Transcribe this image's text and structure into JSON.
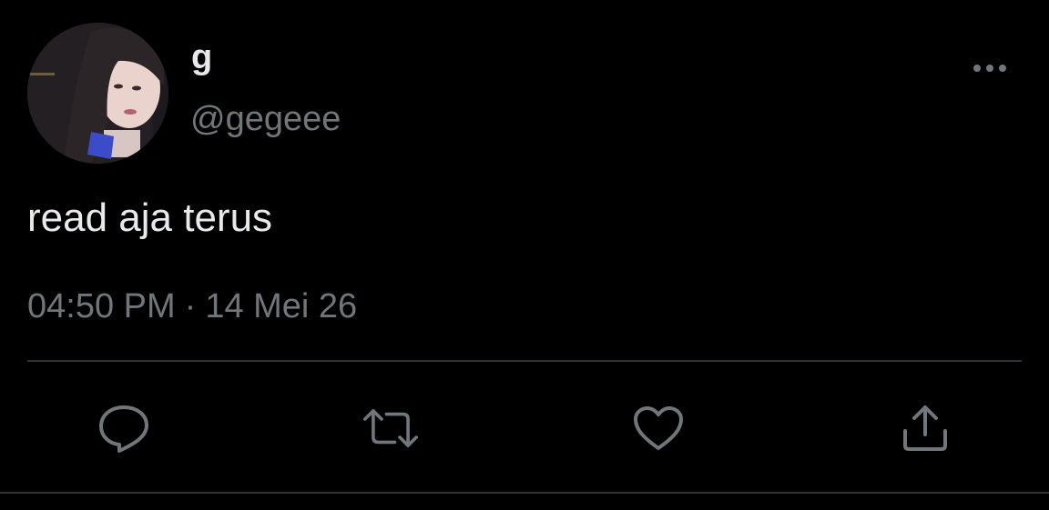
{
  "tweet": {
    "display_name": "g",
    "handle": "@gegeee",
    "text": "read aja terus",
    "time": "04:50 PM",
    "separator": "·",
    "date": "14 Mei 26"
  },
  "icons": {
    "more": "more-horizontal-icon",
    "reply": "reply-icon",
    "retweet": "retweet-icon",
    "like": "heart-icon",
    "share": "share-icon"
  },
  "colors": {
    "background": "#000000",
    "primary_text": "#e7e9ea",
    "secondary_text": "#71767b",
    "divider": "#2f3336"
  }
}
